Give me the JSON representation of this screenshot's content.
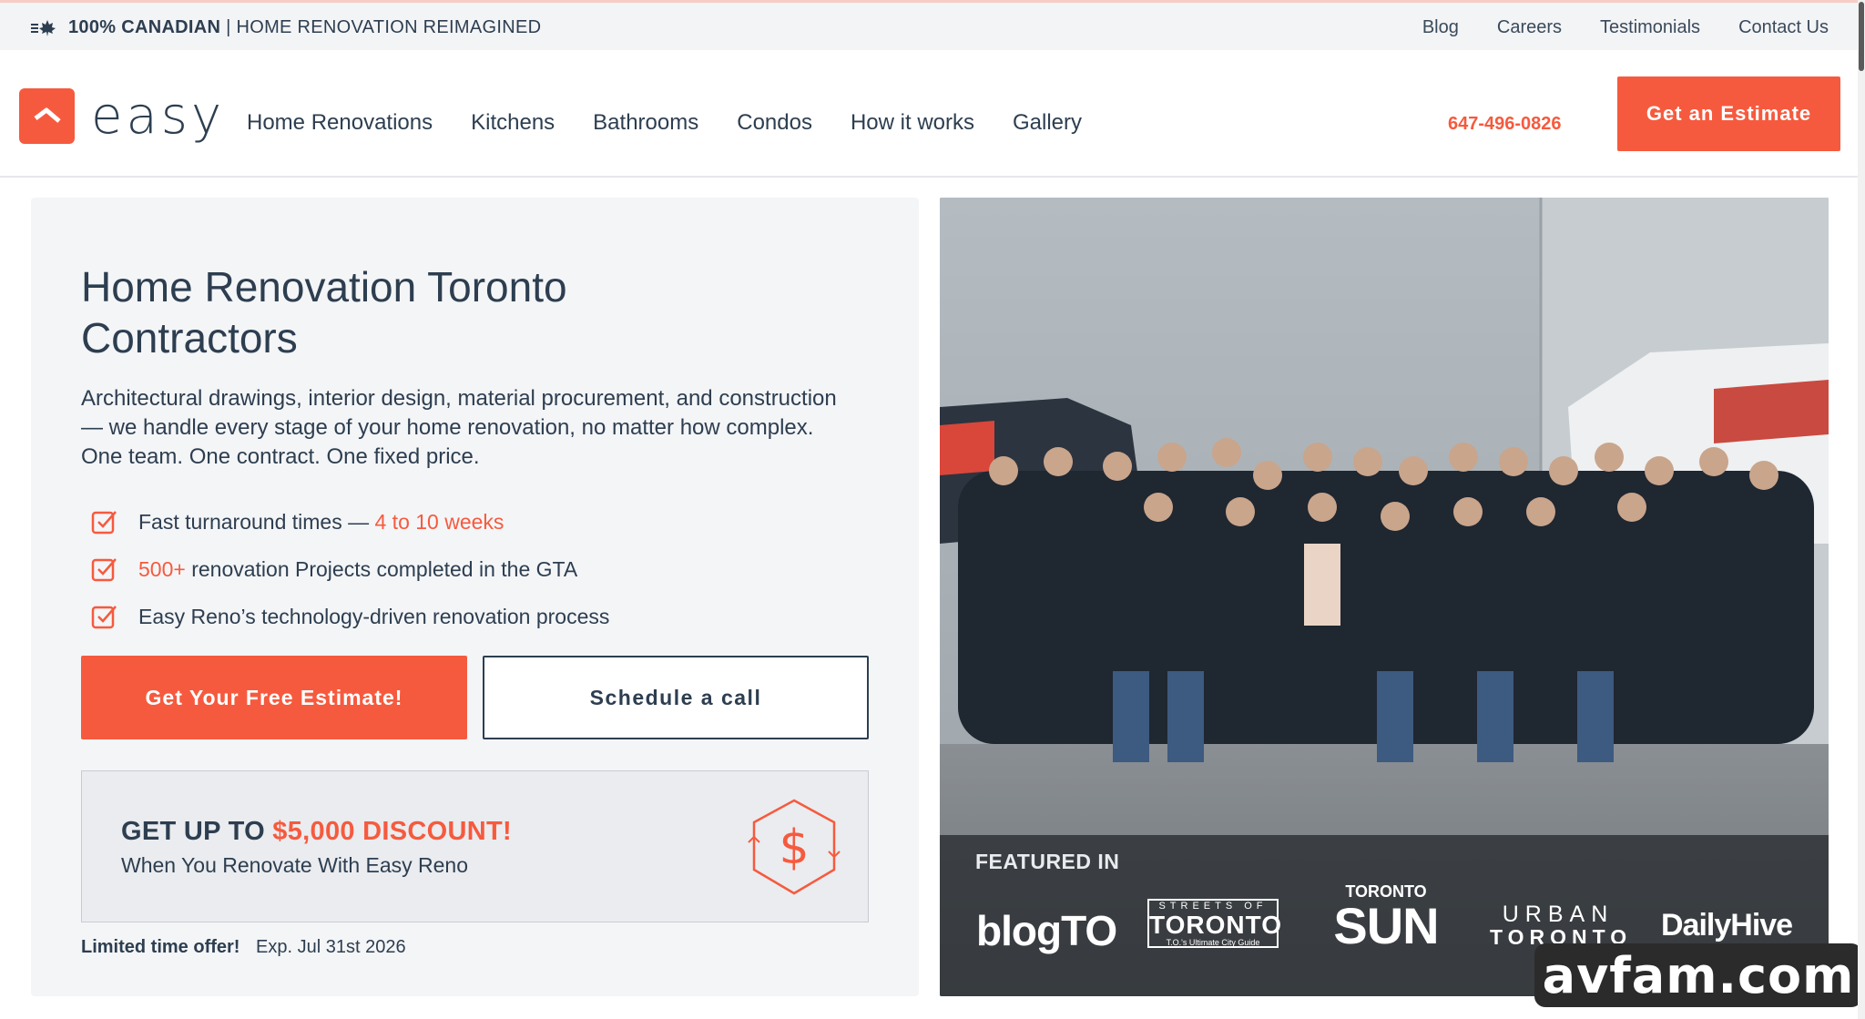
{
  "topbar": {
    "tagline_bold": "100% CANADIAN",
    "tagline_rest": " | HOME RENOVATION REIMAGINED",
    "links": [
      "Blog",
      "Careers",
      "Testimonials",
      "Contact Us"
    ]
  },
  "header": {
    "logo_text": "easy",
    "nav": [
      "Home Renovations",
      "Kitchens",
      "Bathrooms",
      "Condos",
      "How it works",
      "Gallery"
    ],
    "phone": "647-496-0826",
    "estimate_label": "Get an Estimate"
  },
  "hero": {
    "title_line1": "Home Renovation Toronto",
    "title_line2": "Contractors",
    "description": "Architectural drawings, interior design, material procurement, and construction — we handle every stage of your home renovation, no matter how complex. One team. One contract. One fixed price.",
    "checks": [
      {
        "before": "Fast turnaround times — ",
        "accent": "4 to 10 weeks",
        "after": ""
      },
      {
        "before": "",
        "accent": "500+",
        "after": " renovation Projects completed in the GTA"
      },
      {
        "before": "Easy Reno’s technology-driven renovation process",
        "accent": "",
        "after": ""
      }
    ],
    "primary_cta": "Get Your Free Estimate!",
    "secondary_cta": "Schedule a call",
    "discount": {
      "headline_prefix": "GET UP TO ",
      "headline_amount": "$5,000 DISCOUNT!",
      "subline": "When You Renovate With Easy Reno"
    },
    "offer_label": "Limited time offer!",
    "offer_expiry": "Exp. Jul 31st 2026"
  },
  "featured": {
    "label": "FEATURED IN",
    "publications": [
      "blogTO",
      "STREETS OF TORONTO",
      "TORONTO SUN",
      "URBAN TORONTO",
      "DailyHive"
    ],
    "streets_top": "STREETS OF",
    "streets_main": "TORONTO",
    "streets_sub": "T.O.'s Ultimate City Guide",
    "sun_top": "TORONTO",
    "sun_main": "SUN",
    "urban_top": "URBAN",
    "urban_bottom": "TORONTO"
  },
  "watermark": "avfam.com",
  "colors": {
    "accent": "#f65a3e",
    "text": "#2d3e50",
    "panel": "#f4f5f7"
  },
  "icons": [
    "maple-leaf-icon",
    "logo-mark-icon",
    "checkbox-icon",
    "dollar-hexagon-icon"
  ]
}
